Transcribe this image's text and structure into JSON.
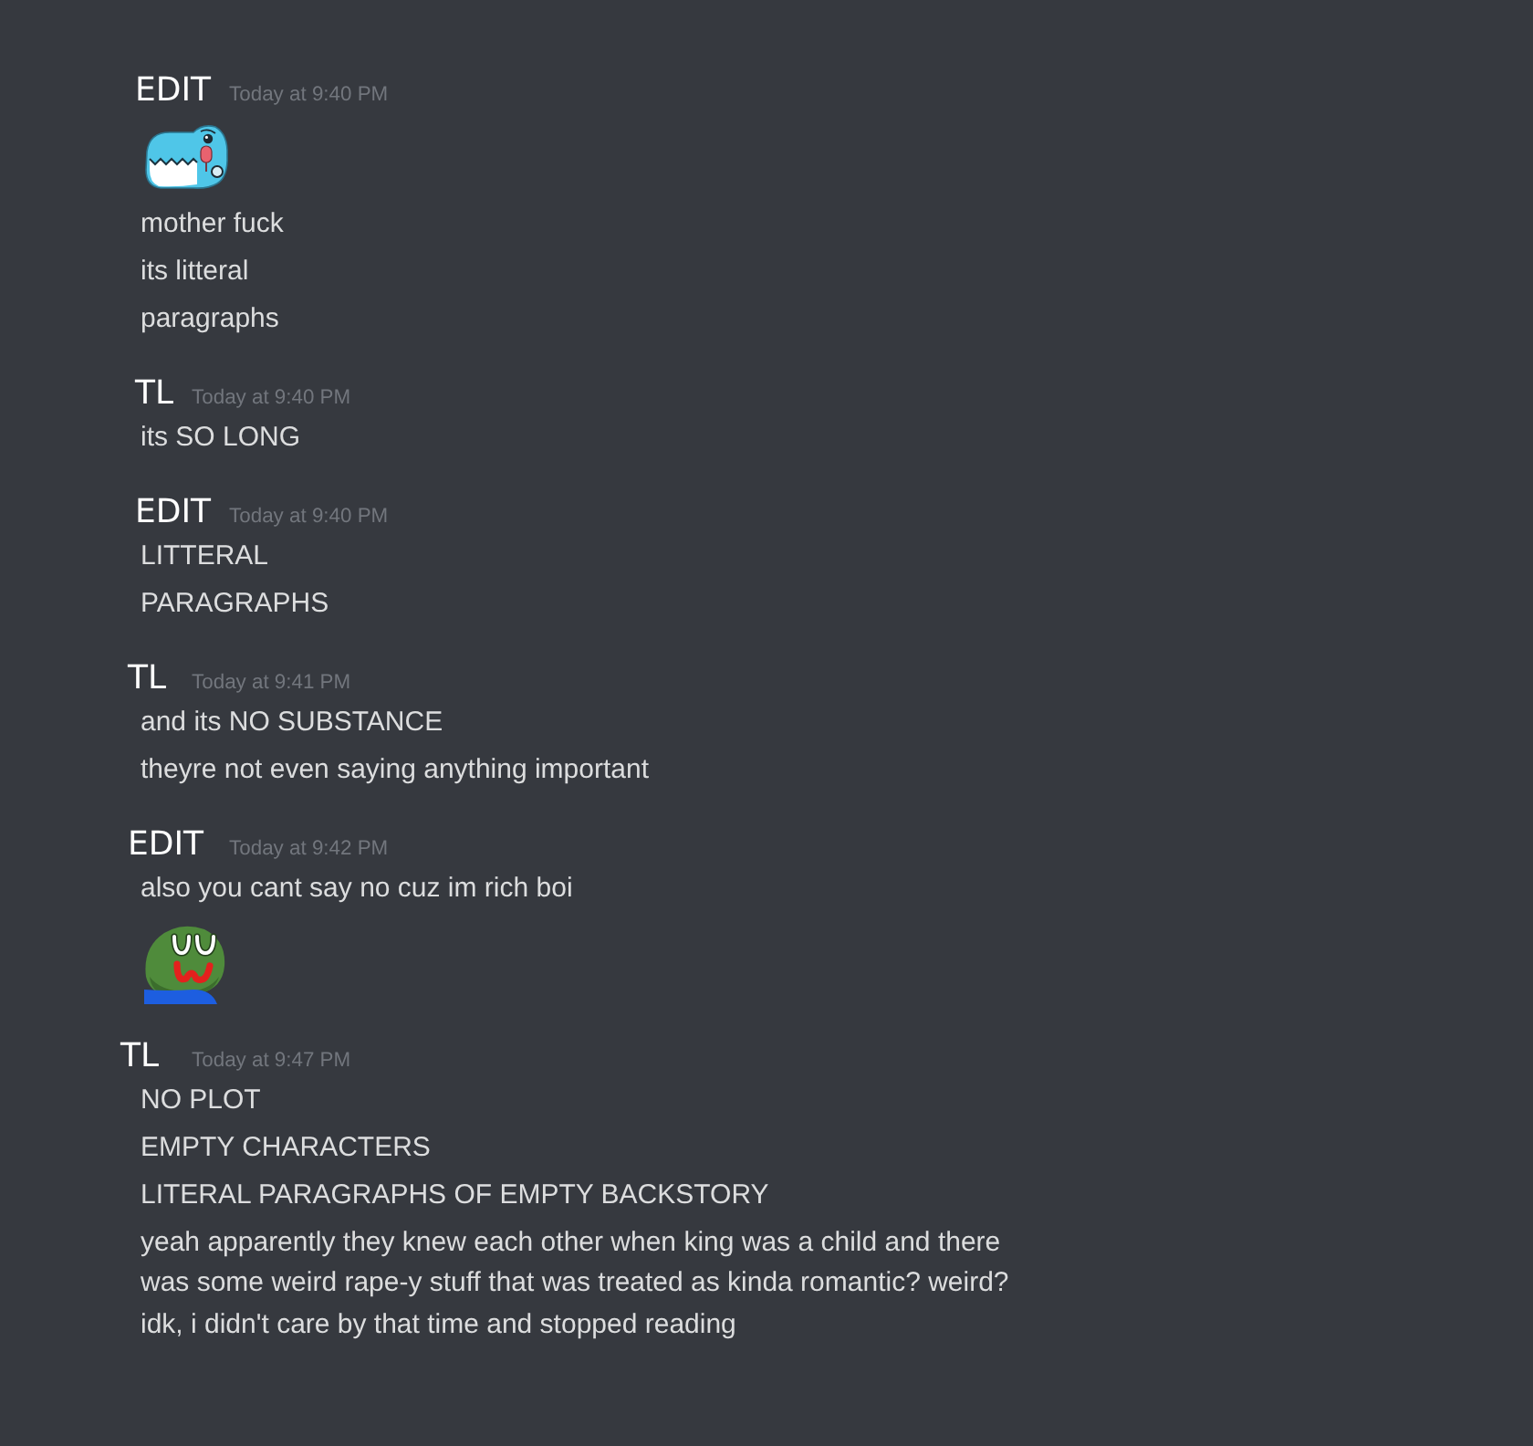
{
  "messages": [
    {
      "author": "EDIT",
      "timestamp": "Today at 9:40 PM",
      "content": [
        {
          "kind": "shark"
        },
        {
          "kind": "text",
          "text": "mother fuck"
        },
        {
          "kind": "text",
          "text": "its litteral"
        },
        {
          "kind": "text",
          "text": "paragraphs"
        }
      ]
    },
    {
      "author": "TL",
      "timestamp": "Today at 9:40 PM",
      "content": [
        {
          "kind": "text",
          "text": "its SO LONG"
        }
      ]
    },
    {
      "author": "EDIT",
      "timestamp": "Today at 9:40 PM",
      "content": [
        {
          "kind": "text",
          "text": "LITTERAL"
        },
        {
          "kind": "text",
          "text": "PARAGRAPHS"
        }
      ]
    },
    {
      "author": "TL",
      "timestamp": "Today at 9:41 PM",
      "content": [
        {
          "kind": "text",
          "text": "and its NO SUBSTANCE"
        },
        {
          "kind": "text",
          "text": "theyre not even saying anything important"
        }
      ]
    },
    {
      "author": "EDIT",
      "timestamp": "Today at 9:42 PM",
      "content": [
        {
          "kind": "text",
          "text": "also you cant say no cuz im rich boi"
        },
        {
          "kind": "frog"
        }
      ]
    },
    {
      "author": "TL",
      "timestamp": "Today at 9:47 PM",
      "content": [
        {
          "kind": "text",
          "text": "NO PLOT"
        },
        {
          "kind": "text",
          "text": "EMPTY CHARACTERS"
        },
        {
          "kind": "text",
          "text": "LITERAL PARAGRAPHS OF EMPTY BACKSTORY"
        },
        {
          "kind": "text",
          "text": "yeah apparently they knew each other when king was a child and there\nwas some weird rape-y stuff that was treated as kinda romantic? weird?\nidk, i didn't care by that time and stopped reading"
        }
      ]
    }
  ]
}
